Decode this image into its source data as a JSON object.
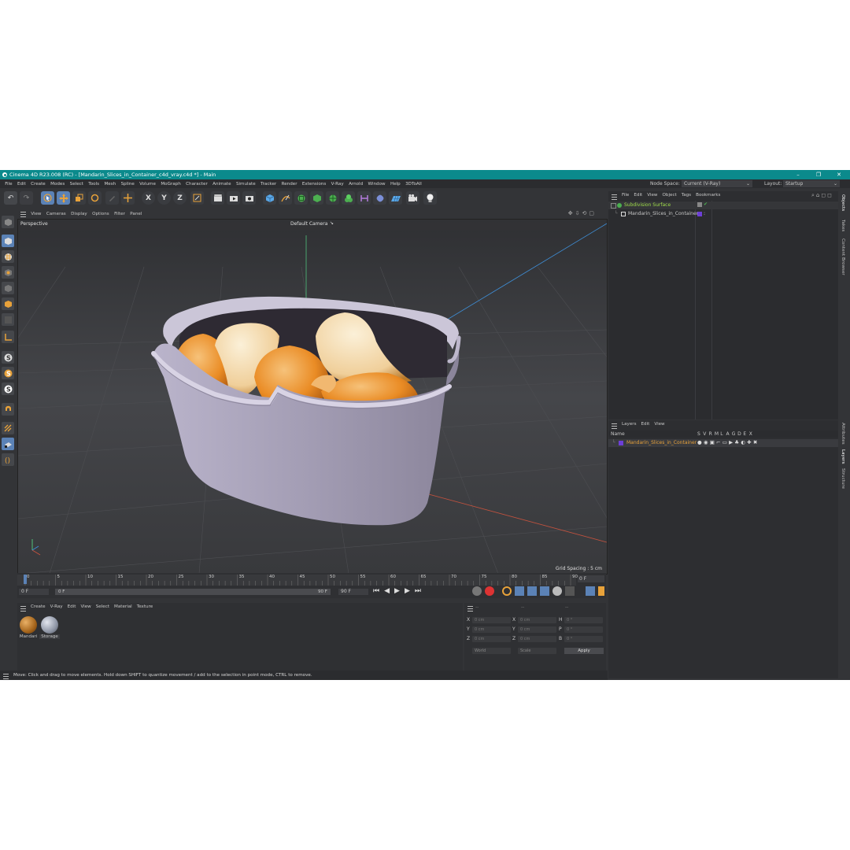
{
  "window": {
    "title": "Cinema 4D R23.008 (RC) - [Mandarin_Slices_in_Container_c4d_vray.c4d *] - Main",
    "controls": [
      "–",
      "❐",
      "✕"
    ]
  },
  "menubar": [
    "File",
    "Edit",
    "Create",
    "Modes",
    "Select",
    "Tools",
    "Mesh",
    "Spline",
    "Volume",
    "MoGraph",
    "Character",
    "Animate",
    "Simulate",
    "Tracker",
    "Render",
    "Extensions",
    "V-Ray",
    "Arnold",
    "Window",
    "Help",
    "3DToAll"
  ],
  "node_space": {
    "label": "Node Space:",
    "value": "Current (V-Ray)"
  },
  "layout": {
    "label": "Layout:",
    "value": "Startup"
  },
  "toolbar": {
    "undo_icon": "↶",
    "redo_icon": "↷",
    "axis_x": "X",
    "axis_y": "Y",
    "axis_z": "Z"
  },
  "viewport": {
    "menu": [
      "View",
      "Cameras",
      "Display",
      "Options",
      "Filter",
      "Panel"
    ],
    "projection": "Perspective",
    "camera": "Default Camera",
    "grid_spacing": "Grid Spacing : 5 cm"
  },
  "timeline": {
    "ticks": [
      "0",
      "5",
      "10",
      "15",
      "20",
      "25",
      "30",
      "35",
      "40",
      "45",
      "50",
      "55",
      "60",
      "65",
      "70",
      "75",
      "80",
      "85",
      "90"
    ],
    "current_frame": "0 F",
    "start": "0 F",
    "range_start": "0 F",
    "range_end": "90 F",
    "end": "90 F"
  },
  "material_manager": {
    "menu": [
      "Create",
      "V-Ray",
      "Edit",
      "View",
      "Select",
      "Material",
      "Texture"
    ],
    "materials": [
      {
        "name": "Mandari",
        "color": "#a5651c"
      },
      {
        "name": "Storage",
        "color": "#8f96a6"
      }
    ]
  },
  "coordinates": {
    "headers": [
      "--",
      "--",
      "--"
    ],
    "rows": [
      {
        "a": "X",
        "av": "0 cm",
        "b": "X",
        "bv": "0 cm",
        "c": "H",
        "cv": "0 °"
      },
      {
        "a": "Y",
        "av": "0 cm",
        "b": "Y",
        "bv": "0 cm",
        "c": "P",
        "cv": "0 °"
      },
      {
        "a": "Z",
        "av": "0 cm",
        "b": "Z",
        "bv": "0 cm",
        "c": "B",
        "cv": "0 °"
      }
    ],
    "mode": "World",
    "scale": "Scale",
    "apply": "Apply"
  },
  "object_manager": {
    "menu": [
      "File",
      "Edit",
      "View",
      "Object",
      "Tags",
      "Bookmarks"
    ],
    "objects": [
      {
        "name": "Subdivision Surface",
        "color": "#9fdc4a"
      },
      {
        "name": "Mandarin_Slices_in_Container",
        "color": "#6d3fd6"
      }
    ]
  },
  "layer_manager": {
    "menu": [
      "Layers",
      "Edit",
      "View"
    ],
    "name_header": "Name",
    "flag_headers": [
      "S",
      "V",
      "R",
      "M",
      "L",
      "A",
      "G",
      "D",
      "E",
      "X"
    ],
    "layers": [
      {
        "name": "Mandarin_Slices_in_Container",
        "color": "#6d3fd6"
      }
    ]
  },
  "side_tabs": [
    "Objects",
    "Takes",
    "Content Browser",
    "Attributes",
    "Layers",
    "Structure"
  ],
  "status": "Move: Click and drag to move elements. Hold down SHIFT to quantize movement / add to the selection in point mode, CTRL to remove.",
  "colors": {
    "title_bar": "#0b8a8c",
    "panel": "#333437",
    "accent_blue": "#5b82b6",
    "container": "#a8a1b8",
    "mandarin": "#e8902a"
  }
}
